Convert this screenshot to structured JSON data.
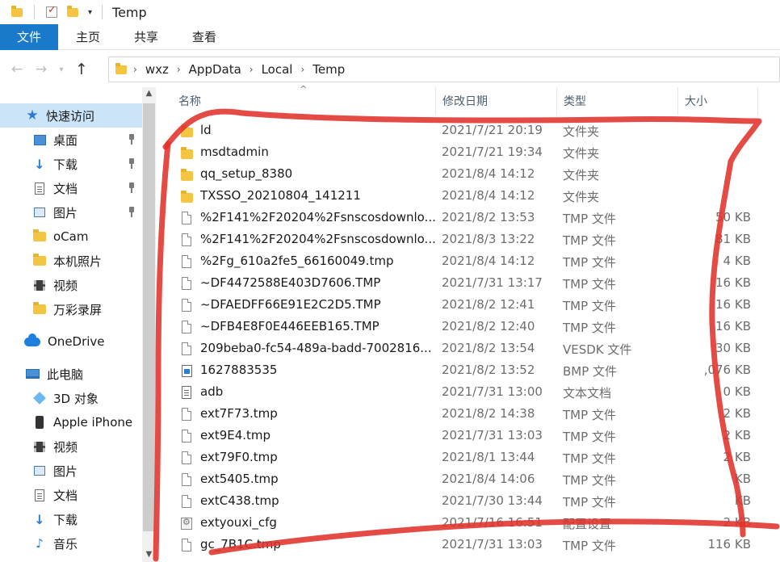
{
  "titlebar": {
    "title": "Temp"
  },
  "ribbon": {
    "tabs": [
      {
        "label": "文件"
      },
      {
        "label": "主页"
      },
      {
        "label": "共享"
      },
      {
        "label": "查看"
      }
    ]
  },
  "address": {
    "crumbs": [
      "wxz",
      "AppData",
      "Local",
      "Temp"
    ],
    "sep": "›"
  },
  "columns": {
    "name": "名称",
    "date": "修改日期",
    "type": "类型",
    "size": "大小"
  },
  "nav": {
    "items": [
      {
        "label": "快速访问",
        "icon": "star-icon"
      },
      {
        "label": "桌面",
        "icon": "desktop-icon",
        "pinned": true
      },
      {
        "label": "下载",
        "icon": "download-icon",
        "pinned": true
      },
      {
        "label": "文档",
        "icon": "document-icon",
        "pinned": true
      },
      {
        "label": "图片",
        "icon": "picture-icon",
        "pinned": true
      },
      {
        "label": "oCam",
        "icon": "folder-icon"
      },
      {
        "label": "本机照片",
        "icon": "folder-icon"
      },
      {
        "label": "视频",
        "icon": "video-icon"
      },
      {
        "label": "万彩录屏",
        "icon": "folder-icon"
      },
      {
        "label": "OneDrive",
        "icon": "cloud-icon"
      },
      {
        "label": "此电脑",
        "icon": "computer-icon"
      },
      {
        "label": "3D 对象",
        "icon": "3d-objects-icon"
      },
      {
        "label": "Apple iPhone",
        "icon": "phone-icon"
      },
      {
        "label": "视频",
        "icon": "video-icon"
      },
      {
        "label": "图片",
        "icon": "picture-icon"
      },
      {
        "label": "文档",
        "icon": "document-icon"
      },
      {
        "label": "下载",
        "icon": "download-icon"
      },
      {
        "label": "音乐",
        "icon": "music-icon"
      }
    ]
  },
  "files": [
    {
      "name": "ld",
      "date": "2021/7/21 20:19",
      "type": "文件夹",
      "size": "",
      "icon": "folder-icon"
    },
    {
      "name": "msdtadmin",
      "date": "2021/7/21 19:34",
      "type": "文件夹",
      "size": "",
      "icon": "folder-icon"
    },
    {
      "name": "qq_setup_8380",
      "date": "2021/8/4 14:12",
      "type": "文件夹",
      "size": "",
      "icon": "folder-icon"
    },
    {
      "name": "TXSSO_20210804_141211",
      "date": "2021/8/4 14:12",
      "type": "文件夹",
      "size": "",
      "icon": "folder-icon"
    },
    {
      "name": "%2F141%2F20204%2Fsnscosdownlo...",
      "date": "2021/8/2 13:53",
      "type": "TMP 文件",
      "size": "50 KB",
      "icon": "file-icon"
    },
    {
      "name": "%2F141%2F20204%2Fsnscosdownlo...",
      "date": "2021/8/3 13:22",
      "type": "TMP 文件",
      "size": "81 KB",
      "icon": "file-icon"
    },
    {
      "name": "%2Fg_610a2fe5_66160049.tmp",
      "date": "2021/8/4 14:12",
      "type": "TMP 文件",
      "size": "4 KB",
      "icon": "file-icon"
    },
    {
      "name": "~DF4472588E403D7606.TMP",
      "date": "2021/7/31 13:17",
      "type": "TMP 文件",
      "size": "16 KB",
      "icon": "file-icon"
    },
    {
      "name": "~DFAEDFF66E91E2C2D5.TMP",
      "date": "2021/8/2 12:41",
      "type": "TMP 文件",
      "size": "16 KB",
      "icon": "file-icon"
    },
    {
      "name": "~DFB4E8F0E446EEB165.TMP",
      "date": "2021/8/2 12:40",
      "type": "TMP 文件",
      "size": "16 KB",
      "icon": "file-icon"
    },
    {
      "name": "209beba0-fc54-489a-badd-7002816...",
      "date": "2021/8/2 13:54",
      "type": "VESDK 文件",
      "size": "30 KB",
      "icon": "file-icon"
    },
    {
      "name": "1627883535",
      "date": "2021/8/2 13:52",
      "type": "BMP 文件",
      "size": ",076 KB",
      "icon": "bmp-icon"
    },
    {
      "name": "adb",
      "date": "2021/7/31 13:00",
      "type": "文本文档",
      "size": "0 KB",
      "icon": "text-file-icon"
    },
    {
      "name": "ext7F73.tmp",
      "date": "2021/8/2 14:38",
      "type": "TMP 文件",
      "size": "2 KB",
      "icon": "file-icon"
    },
    {
      "name": "ext9E4.tmp",
      "date": "2021/7/31 13:03",
      "type": "TMP 文件",
      "size": "2 KB",
      "icon": "file-icon"
    },
    {
      "name": "ext79F0.tmp",
      "date": "2021/8/1 13:44",
      "type": "TMP 文件",
      "size": "2 KB",
      "icon": "file-icon"
    },
    {
      "name": "ext5405.tmp",
      "date": "2021/8/4 14:06",
      "type": "TMP 文件",
      "size": "KB",
      "icon": "file-icon"
    },
    {
      "name": "extC438.tmp",
      "date": "2021/7/30 13:44",
      "type": "TMP 文件",
      "size": "KB",
      "icon": "file-icon"
    },
    {
      "name": "extyouxi_cfg",
      "date": "2021/7/16 16:51",
      "type": "配置设置",
      "size": "2 KB",
      "icon": "config-icon"
    },
    {
      "name": "gc_7B1C.tmp",
      "date": "2021/7/31 13:03",
      "type": "TMP 文件",
      "size": "116 KB",
      "icon": "file-icon"
    }
  ],
  "colors": {
    "file_tab": "#1979ca",
    "selection": "#cce4f7",
    "scribble": "#e0322b"
  }
}
